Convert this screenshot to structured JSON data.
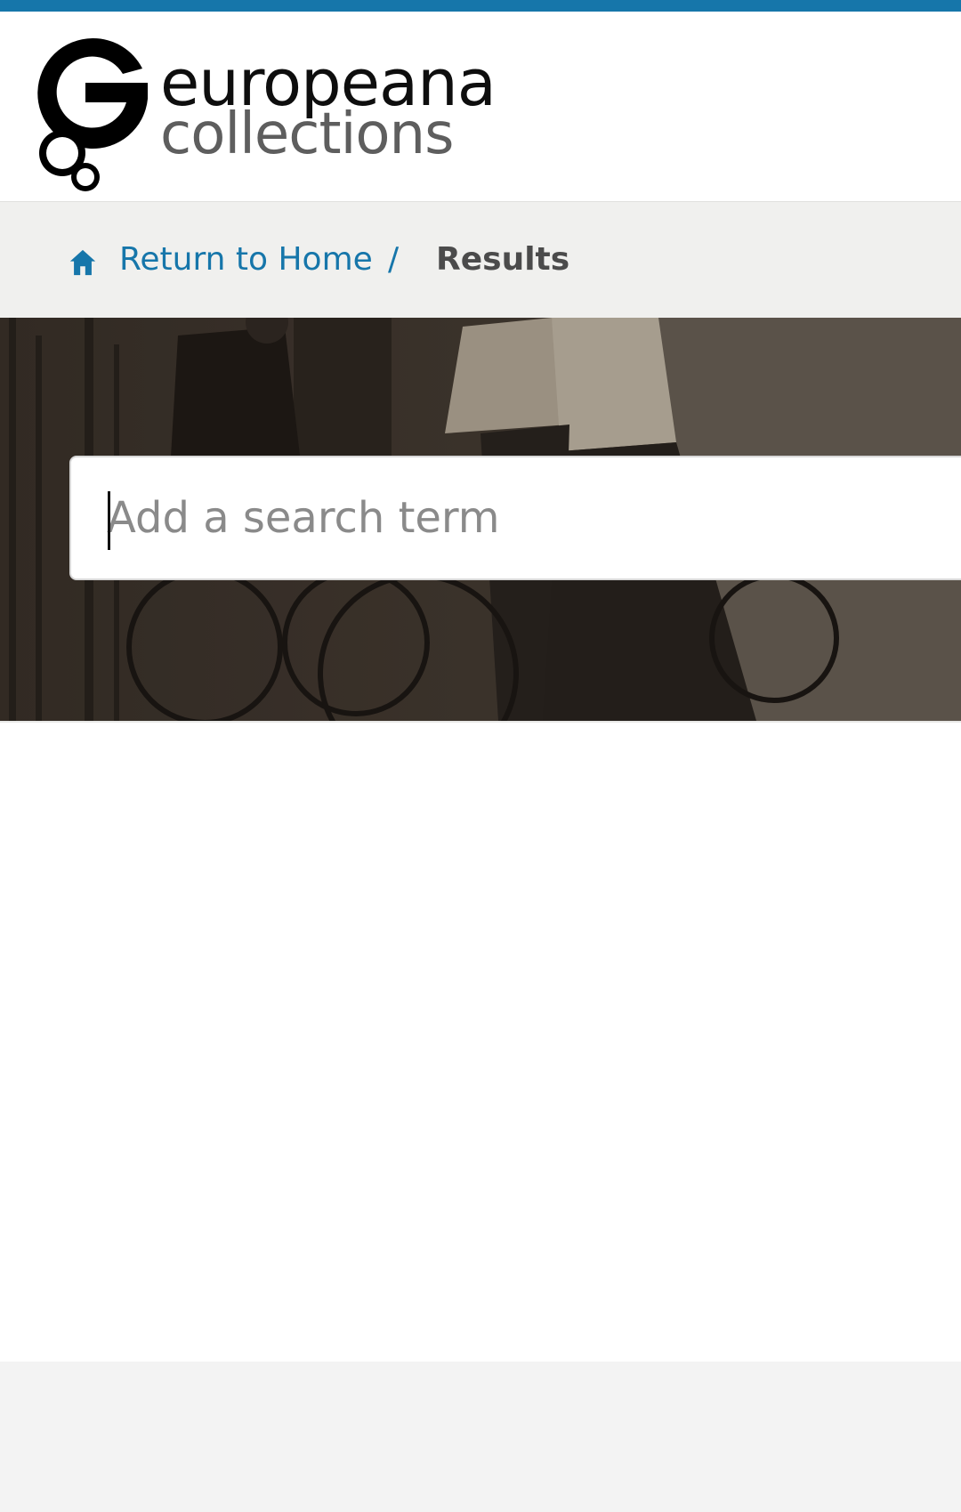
{
  "brand": {
    "line1": "europeana",
    "line2": "collections",
    "accent_color": "#1676aa"
  },
  "breadcrumb": {
    "home_label": "Return to Home",
    "separator": "/",
    "current": "Results",
    "home_icon": "home-icon"
  },
  "search": {
    "placeholder": "Add a search term",
    "value": ""
  }
}
